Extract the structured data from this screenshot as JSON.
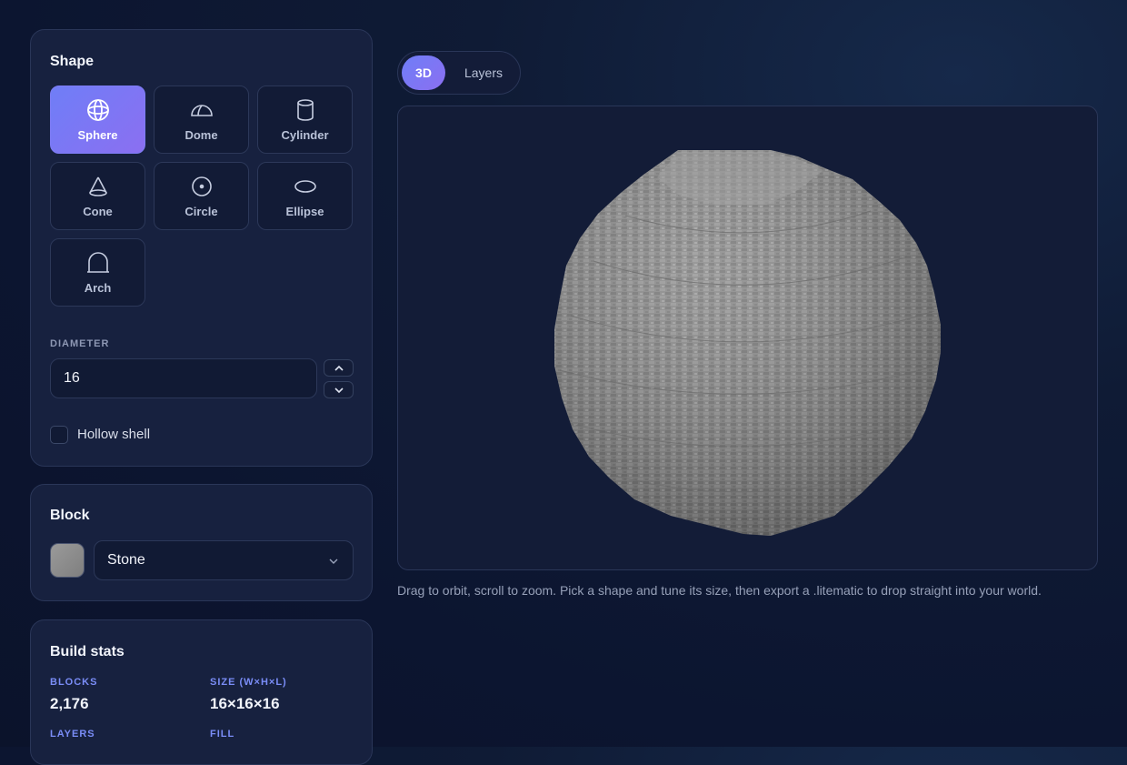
{
  "shape_panel": {
    "title": "Shape",
    "shapes": [
      {
        "label": "Sphere",
        "icon": "sphere-icon",
        "active": true
      },
      {
        "label": "Dome",
        "icon": "dome-icon"
      },
      {
        "label": "Cylinder",
        "icon": "cylinder-icon"
      },
      {
        "label": "Cone",
        "icon": "cone-icon"
      },
      {
        "label": "Circle",
        "icon": "circle-icon"
      },
      {
        "label": "Ellipse",
        "icon": "ellipse-icon"
      },
      {
        "label": "Arch",
        "icon": "arch-icon"
      }
    ],
    "diameter_label": "DIAMETER",
    "diameter_value": "16",
    "hollow_label": "Hollow shell",
    "hollow_checked": false
  },
  "block_panel": {
    "title": "Block",
    "selected": "Stone",
    "swatch_color": "#8f8f8f"
  },
  "stats_panel": {
    "title": "Build stats",
    "stats": [
      {
        "label": "BLOCKS",
        "value": "2,176"
      },
      {
        "label": "SIZE (W×H×L)",
        "value": "16×16×16"
      },
      {
        "label": "LAYERS",
        "value": ""
      },
      {
        "label": "FILL",
        "value": ""
      }
    ]
  },
  "view_tabs": [
    {
      "label": "3D",
      "active": true
    },
    {
      "label": "Layers",
      "active": false
    }
  ],
  "hint": "Drag to orbit, scroll to zoom. Pick a shape and tune its size, then export a .litematic to drop straight into your world.",
  "colors": {
    "accent": "#7b7df5",
    "background": "#0c1530",
    "panel": "#17213f",
    "stone": "#8f8f8f"
  }
}
